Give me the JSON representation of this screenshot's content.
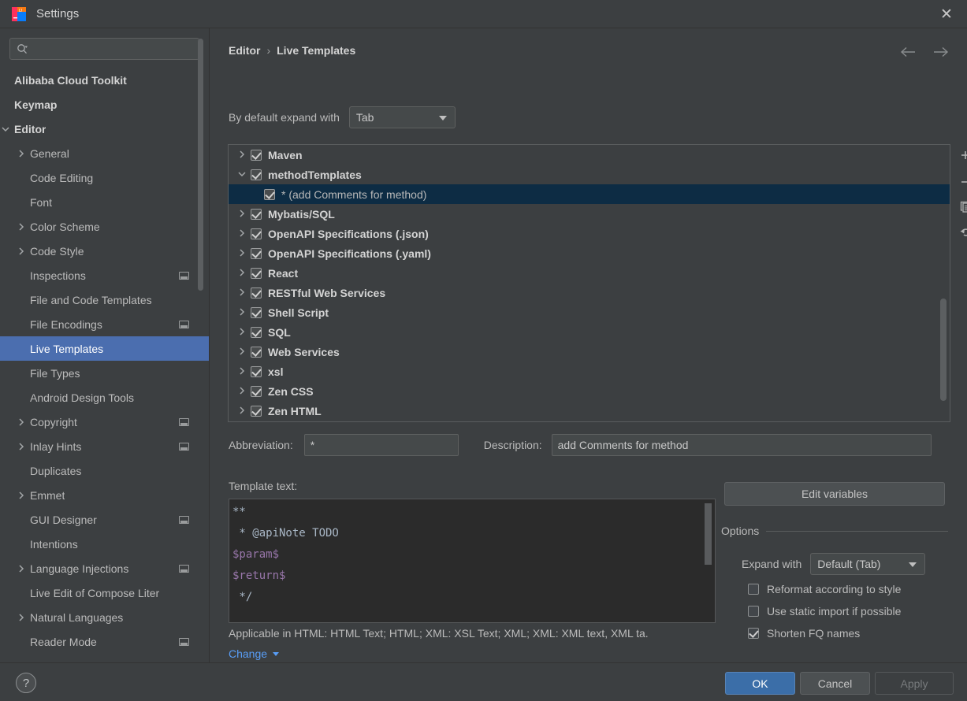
{
  "window": {
    "title": "Settings",
    "logo_icon": "intellij-idea-logo",
    "close_icon": "close-icon"
  },
  "sidebar": {
    "search": {
      "placeholder": "",
      "value": "",
      "icon": "search-icon"
    },
    "items": [
      {
        "label": "Alibaba Cloud Toolkit",
        "indent": 0,
        "twisty": "none",
        "bold": true,
        "selected": false,
        "sub_icon": false
      },
      {
        "label": "Keymap",
        "indent": 0,
        "twisty": "none",
        "bold": true,
        "selected": false,
        "sub_icon": false
      },
      {
        "label": "Editor",
        "indent": 0,
        "twisty": "expanded",
        "bold": true,
        "selected": false,
        "sub_icon": false
      },
      {
        "label": "General",
        "indent": 1,
        "twisty": "collapsed",
        "bold": false,
        "selected": false,
        "sub_icon": false
      },
      {
        "label": "Code Editing",
        "indent": 1,
        "twisty": "none",
        "bold": false,
        "selected": false,
        "sub_icon": false
      },
      {
        "label": "Font",
        "indent": 1,
        "twisty": "none",
        "bold": false,
        "selected": false,
        "sub_icon": false
      },
      {
        "label": "Color Scheme",
        "indent": 1,
        "twisty": "collapsed",
        "bold": false,
        "selected": false,
        "sub_icon": false
      },
      {
        "label": "Code Style",
        "indent": 1,
        "twisty": "collapsed",
        "bold": false,
        "selected": false,
        "sub_icon": false
      },
      {
        "label": "Inspections",
        "indent": 1,
        "twisty": "none",
        "bold": false,
        "selected": false,
        "sub_icon": true
      },
      {
        "label": "File and Code Templates",
        "indent": 1,
        "twisty": "none",
        "bold": false,
        "selected": false,
        "sub_icon": false
      },
      {
        "label": "File Encodings",
        "indent": 1,
        "twisty": "none",
        "bold": false,
        "selected": false,
        "sub_icon": true
      },
      {
        "label": "Live Templates",
        "indent": 1,
        "twisty": "none",
        "bold": false,
        "selected": true,
        "sub_icon": false
      },
      {
        "label": "File Types",
        "indent": 1,
        "twisty": "none",
        "bold": false,
        "selected": false,
        "sub_icon": false
      },
      {
        "label": "Android Design Tools",
        "indent": 1,
        "twisty": "none",
        "bold": false,
        "selected": false,
        "sub_icon": false
      },
      {
        "label": "Copyright",
        "indent": 1,
        "twisty": "collapsed",
        "bold": false,
        "selected": false,
        "sub_icon": true
      },
      {
        "label": "Inlay Hints",
        "indent": 1,
        "twisty": "collapsed",
        "bold": false,
        "selected": false,
        "sub_icon": true
      },
      {
        "label": "Duplicates",
        "indent": 1,
        "twisty": "none",
        "bold": false,
        "selected": false,
        "sub_icon": false
      },
      {
        "label": "Emmet",
        "indent": 1,
        "twisty": "collapsed",
        "bold": false,
        "selected": false,
        "sub_icon": false
      },
      {
        "label": "GUI Designer",
        "indent": 1,
        "twisty": "none",
        "bold": false,
        "selected": false,
        "sub_icon": true
      },
      {
        "label": "Intentions",
        "indent": 1,
        "twisty": "none",
        "bold": false,
        "selected": false,
        "sub_icon": false
      },
      {
        "label": "Language Injections",
        "indent": 1,
        "twisty": "collapsed",
        "bold": false,
        "selected": false,
        "sub_icon": true
      },
      {
        "label": "Live Edit of Compose Liter",
        "indent": 1,
        "twisty": "none",
        "bold": false,
        "selected": false,
        "sub_icon": false
      },
      {
        "label": "Natural Languages",
        "indent": 1,
        "twisty": "collapsed",
        "bold": false,
        "selected": false,
        "sub_icon": false
      },
      {
        "label": "Reader Mode",
        "indent": 1,
        "twisty": "none",
        "bold": false,
        "selected": false,
        "sub_icon": true
      }
    ]
  },
  "content": {
    "breadcrumb": {
      "root": "Editor",
      "separator": "›",
      "leaf": "Live Templates"
    },
    "nav": {
      "back_icon": "arrow-left-icon",
      "forward_icon": "arrow-right-icon"
    },
    "expand_with": {
      "label": "By default expand with",
      "value": "Tab"
    },
    "tree": [
      {
        "label": "Maven",
        "twisty": "collapsed",
        "checked": true,
        "child": false,
        "selected": false
      },
      {
        "label": "methodTemplates",
        "twisty": "expanded",
        "checked": true,
        "child": false,
        "selected": false
      },
      {
        "label": "* (add Comments for method)",
        "twisty": "none",
        "checked": true,
        "child": true,
        "selected": true
      },
      {
        "label": "Mybatis/SQL",
        "twisty": "collapsed",
        "checked": true,
        "child": false,
        "selected": false
      },
      {
        "label": "OpenAPI Specifications (.json)",
        "twisty": "collapsed",
        "checked": true,
        "child": false,
        "selected": false
      },
      {
        "label": "OpenAPI Specifications (.yaml)",
        "twisty": "collapsed",
        "checked": true,
        "child": false,
        "selected": false
      },
      {
        "label": "React",
        "twisty": "collapsed",
        "checked": true,
        "child": false,
        "selected": false
      },
      {
        "label": "RESTful Web Services",
        "twisty": "collapsed",
        "checked": true,
        "child": false,
        "selected": false
      },
      {
        "label": "Shell Script",
        "twisty": "collapsed",
        "checked": true,
        "child": false,
        "selected": false
      },
      {
        "label": "SQL",
        "twisty": "collapsed",
        "checked": true,
        "child": false,
        "selected": false
      },
      {
        "label": "Web Services",
        "twisty": "collapsed",
        "checked": true,
        "child": false,
        "selected": false
      },
      {
        "label": "xsl",
        "twisty": "collapsed",
        "checked": true,
        "child": false,
        "selected": false
      },
      {
        "label": "Zen CSS",
        "twisty": "collapsed",
        "checked": true,
        "child": false,
        "selected": false
      },
      {
        "label": "Zen HTML",
        "twisty": "collapsed",
        "checked": true,
        "child": false,
        "selected": false
      }
    ],
    "tree_toolbar": [
      {
        "name": "add-button",
        "icon": "plus-icon"
      },
      {
        "name": "remove-button",
        "icon": "minus-icon"
      },
      {
        "name": "duplicate-button",
        "icon": "copy-icon"
      },
      {
        "name": "revert-button",
        "icon": "undo-icon"
      }
    ],
    "abbreviation": {
      "label": "Abbreviation:",
      "value": "*"
    },
    "description": {
      "label": "Description:",
      "value": "add Comments for method"
    },
    "template": {
      "label": "Template text:",
      "lines": [
        {
          "text": "**",
          "kind": "plain"
        },
        {
          "text": " * @apiNote TODO",
          "kind": "plain"
        },
        {
          "text": "$param$",
          "kind": "var"
        },
        {
          "text": "$return$",
          "kind": "var"
        },
        {
          "text": " */",
          "kind": "plain"
        }
      ]
    },
    "applicable": "Applicable in HTML: HTML Text; HTML; XML: XSL Text; XML; XML: XML text, XML ta.",
    "change_link": "Change",
    "edit_variables_button": "Edit variables",
    "options": {
      "title": "Options",
      "expand_with": {
        "label": "Expand with",
        "value": "Default (Tab)"
      },
      "checkboxes": [
        {
          "label": "Reformat according to style",
          "checked": false
        },
        {
          "label": "Use static import if possible",
          "checked": false
        },
        {
          "label": "Shorten FQ names",
          "checked": true
        }
      ]
    }
  },
  "footer": {
    "help_icon": "question-mark-icon",
    "ok": "OK",
    "cancel": "Cancel",
    "apply": "Apply"
  },
  "colors": {
    "background": "#3c3f41",
    "selection_blue": "#4b6eaf",
    "tree_selection": "#0d2c44",
    "accent_link": "#589df6",
    "ok_button": "#3b6ea8",
    "code_variable": "#9876aa",
    "code_text": "#a9b7c6"
  }
}
